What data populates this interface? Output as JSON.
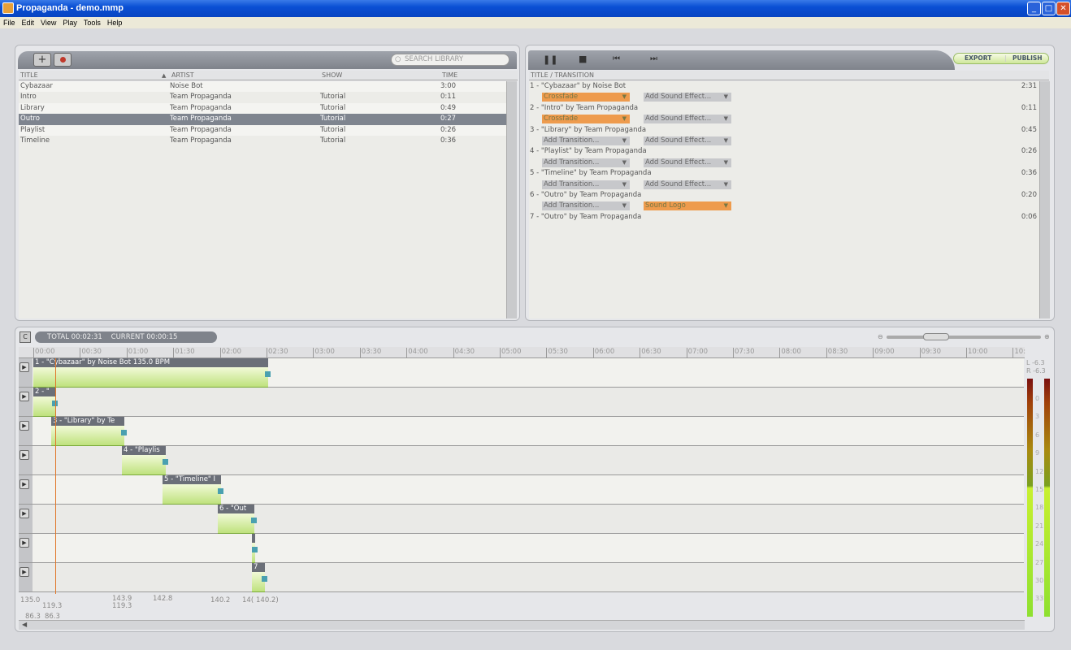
{
  "window": {
    "title": "Propaganda - demo.mmp",
    "controls": [
      "_",
      "□",
      "✕"
    ]
  },
  "menu": [
    "File",
    "Edit",
    "View",
    "Play",
    "Tools",
    "Help"
  ],
  "library": {
    "search_placeholder": "SEARCH LIBRARY",
    "columns": [
      "TITLE",
      "ARTIST",
      "SHOW",
      "TIME"
    ],
    "rows": [
      {
        "title": "Cybazaar",
        "artist": "Noise Bot",
        "show": "",
        "time": "3:00"
      },
      {
        "title": "Intro",
        "artist": "Team Propaganda",
        "show": "Tutorial",
        "time": "0:11"
      },
      {
        "title": "Library",
        "artist": "Team Propaganda",
        "show": "Tutorial",
        "time": "0:49"
      },
      {
        "title": "Outro",
        "artist": "Team Propaganda",
        "show": "Tutorial",
        "time": "0:27",
        "selected": true
      },
      {
        "title": "Playlist",
        "artist": "Team Propaganda",
        "show": "Tutorial",
        "time": "0:26"
      },
      {
        "title": "Timeline",
        "artist": "Team Propaganda",
        "show": "Tutorial",
        "time": "0:36"
      }
    ]
  },
  "playlist": {
    "export_label": "EXPORT",
    "publish_label": "PUBLISH",
    "header": "TITLE / TRANSITION",
    "items": [
      {
        "title": "1 - \"Cybazaar\" by Noise Bot",
        "time": "2:31",
        "transition": "Crossfade",
        "effect": "Add Sound Effect..."
      },
      {
        "title": "2 - \"Intro\" by Team Propaganda",
        "time": "0:11",
        "transition": "Crossfade",
        "effect": "Add Sound Effect..."
      },
      {
        "title": "3 - \"Library\" by Team Propaganda",
        "time": "0:45",
        "transition": "Add Transition...",
        "effect": "Add Sound Effect..."
      },
      {
        "title": "4 - \"Playlist\" by Team Propaganda",
        "time": "0:26",
        "transition": "Add Transition...",
        "effect": "Add Sound Effect..."
      },
      {
        "title": "5 - \"Timeline\" by Team Propaganda",
        "time": "0:36",
        "transition": "Add Transition...",
        "effect": "Add Sound Effect..."
      },
      {
        "title": "6 - \"Outro\" by Team Propaganda",
        "time": "0:20",
        "transition": "Add Transition...",
        "effect": "Sound Logo"
      },
      {
        "title": "7 - \"Outro\" by Team Propaganda",
        "time": "0:06"
      }
    ]
  },
  "timeline": {
    "c_label": "C",
    "status": "TOTAL 00:02:31    CURRENT 00:00:15",
    "ticks": [
      "00:00",
      "00:30",
      "01:00",
      "01:30",
      "02:00",
      "02:30",
      "03:00",
      "03:30",
      "04:00",
      "04:30",
      "05:00",
      "05:30",
      "06:00",
      "06:30",
      "07:00",
      "07:30",
      "08:00",
      "08:30",
      "09:00",
      "09:30",
      "10:00",
      "10:"
    ],
    "clips": [
      "1 - \"Cybazaar\" by Noise Bot 135.0 BPM",
      "2 - \"",
      "3 - \"Library\" by Te",
      "4 - \"Playlis",
      "5 - \"Timeline\" I",
      "6 - \"Out",
      "",
      "7"
    ],
    "bpm_labels": [
      "135.0",
      "119.3",
      "143.9",
      "119.3",
      "142.8",
      "140.2",
      "14(",
      "140.2)",
      "86.3",
      "86.3"
    ],
    "meter": {
      "l_label": "L",
      "l_value": "-6.3",
      "r_label": "R",
      "r_value": "-6.3",
      "scale": [
        "0",
        "3",
        "6",
        "9",
        "12",
        "15",
        "18",
        "21",
        "24",
        "27",
        "30",
        "33"
      ]
    }
  },
  "colors": {
    "accent": "#ee9b4d",
    "wave": "#bfe27d",
    "handle": "#4aa0b0",
    "selection": "#7f858f"
  }
}
